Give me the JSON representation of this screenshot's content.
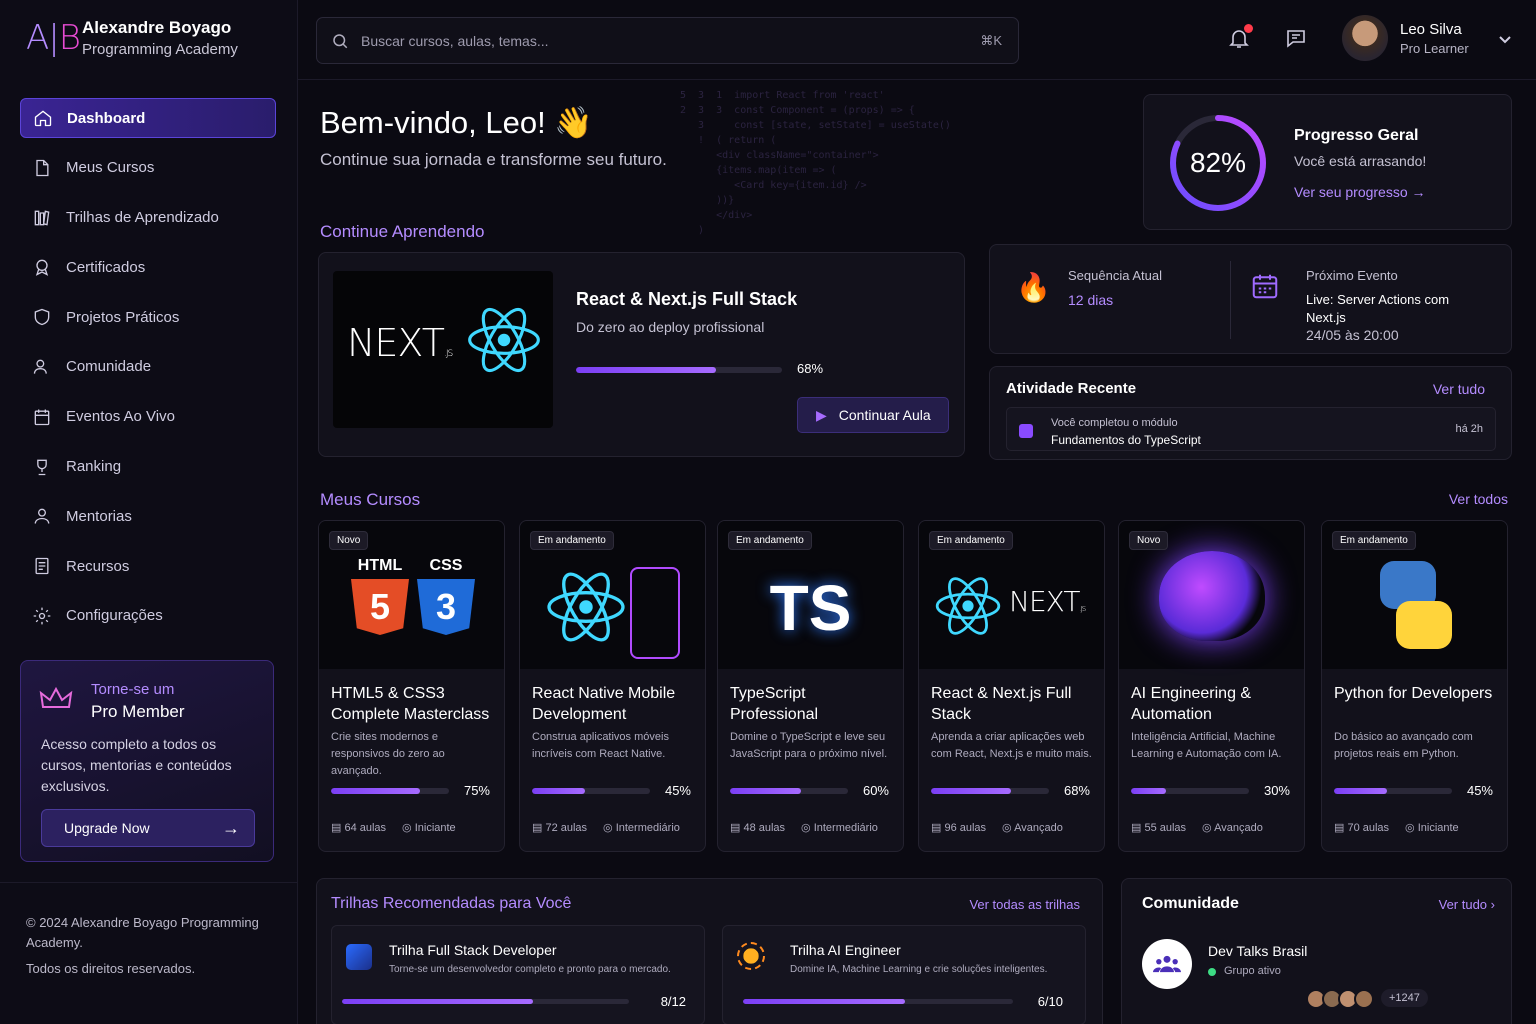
{
  "brand": {
    "mark_a": "A",
    "mark_b": "B",
    "line1": "Alexandre Boyago",
    "line2": "Programming Academy"
  },
  "nav": [
    {
      "label": "Dashboard",
      "icon": "home-icon"
    },
    {
      "label": "Meus Cursos",
      "icon": "file-icon"
    },
    {
      "label": "Trilhas de Aprendizado",
      "icon": "books-icon"
    },
    {
      "label": "Certificados",
      "icon": "badge-icon"
    },
    {
      "label": "Projetos Práticos",
      "icon": "shield-icon"
    },
    {
      "label": "Comunidade",
      "icon": "users-icon"
    },
    {
      "label": "Eventos Ao Vivo",
      "icon": "calendar-icon"
    },
    {
      "label": "Ranking",
      "icon": "trophy-icon"
    },
    {
      "label": "Mentorias",
      "icon": "mentor-icon"
    },
    {
      "label": "Recursos",
      "icon": "resources-icon"
    },
    {
      "label": "Configurações",
      "icon": "gear-icon"
    }
  ],
  "pro": {
    "title1": "Torne-se um",
    "title2": "Pro Member",
    "desc": "Acesso completo a todos os cursos, mentorias e conteúdos exclusivos.",
    "button": "Upgrade Now"
  },
  "footer": {
    "line1": "© 2024 Alexandre Boyago Programming Academy.",
    "line2": "Todos os direitos reservados."
  },
  "search": {
    "placeholder": "Buscar cursos, aulas, temas...",
    "shortcut": "⌘K"
  },
  "user": {
    "name": "Leo Silva",
    "role": "Pro Learner"
  },
  "welcome": {
    "title": "Bem-vindo, Leo! 👋",
    "subtitle": "Continue sua jornada e transforme seu futuro."
  },
  "progress": {
    "value": 82,
    "label": "82%",
    "title": "Progresso Geral",
    "subtitle": "Você está arrasando!",
    "link": "Ver seu progresso"
  },
  "streak": {
    "label": "Sequência Atual",
    "value": "12 dias"
  },
  "event": {
    "label": "Próximo Evento",
    "title": "Live: Server Actions com Next.js",
    "date": "24/05 às 20:00"
  },
  "activity": {
    "title": "Atividade Recente",
    "link": "Ver tudo",
    "line1": "Você completou o módulo",
    "line2": "Fundamentos do TypeScript",
    "time": "há 2h"
  },
  "continue": {
    "section": "Continue Aprendendo",
    "course": "React & Next.js Full Stack",
    "desc": "Do zero ao deploy profissional",
    "progress": 68,
    "progress_label": "68%",
    "button": "Continuar Aula",
    "thumb_text": "NEXT",
    "thumb_sub": ".JS"
  },
  "courses_section": {
    "title": "Meus Cursos",
    "link": "Ver todos"
  },
  "courses": [
    {
      "badge": "Novo",
      "title": "HTML5 & CSS3 Complete Masterclass",
      "desc": "Crie sites modernos e responsivos do zero ao avançado.",
      "progress": 75,
      "pct": "75%",
      "lessons": "64 aulas",
      "level": "Iniciante",
      "art": "html"
    },
    {
      "badge": "Em andamento",
      "title": "React Native Mobile Development",
      "desc": "Construa aplicativos móveis incríveis com React Native.",
      "progress": 45,
      "pct": "45%",
      "lessons": "72 aulas",
      "level": "Intermediário",
      "art": "rn"
    },
    {
      "badge": "Em andamento",
      "title": "TypeScript Professional",
      "desc": "Domine o TypeScript e leve seu JavaScript para o próximo nível.",
      "progress": 60,
      "pct": "60%",
      "lessons": "48 aulas",
      "level": "Intermediário",
      "art": "ts"
    },
    {
      "badge": "Em andamento",
      "title": "React & Next.js Full Stack",
      "desc": "Aprenda a criar aplicações web com React, Next.js e muito mais.",
      "progress": 68,
      "pct": "68%",
      "lessons": "96 aulas",
      "level": "Avançado",
      "art": "next"
    },
    {
      "badge": "Novo",
      "title": "AI Engineering & Automation",
      "desc": "Inteligência Artificial, Machine Learning e Automação com IA.",
      "progress": 30,
      "pct": "30%",
      "lessons": "55 aulas",
      "level": "Avançado",
      "art": "ai"
    },
    {
      "badge": "Em andamento",
      "title": "Python for Developers",
      "desc": "Do básico ao avançado com projetos reais em Python.",
      "progress": 45,
      "pct": "45%",
      "lessons": "70 aulas",
      "level": "Iniciante",
      "art": "py"
    }
  ],
  "art": {
    "html": "HTML",
    "css": "CSS",
    "h5": "5",
    "c3": "3",
    "ts": "TS",
    "next": "NEXT",
    "js": ".JS"
  },
  "trails": {
    "title": "Trilhas Recomendadas para Você",
    "link": "Ver todas as trilhas",
    "items": [
      {
        "title": "Trilha Full Stack Developer",
        "desc": "Torne-se um desenvolvedor completo e pronto para o mercado.",
        "progress": 0.667,
        "count": "8/12"
      },
      {
        "title": "Trilha AI Engineer",
        "desc": "Domine IA, Machine Learning e crie soluções inteligentes.",
        "progress": 0.6,
        "count": "6/10"
      }
    ]
  },
  "community": {
    "title": "Comunidade",
    "link": "Ver tudo",
    "group": "Dev Talks Brasil",
    "status": "Grupo ativo",
    "members": "+1247"
  },
  "colors": {
    "accent": "#b48cff",
    "primary": "#7b3ff5",
    "bg": "#0b0a12"
  }
}
